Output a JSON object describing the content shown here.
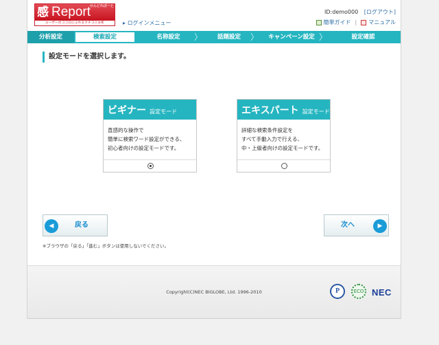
{
  "header": {
    "logo_heart": "感",
    "logo_name": "Report",
    "logo_ruby": "かんどれぽーと",
    "logo_tagline": "ユーザーのココロにふれるクチコミ分析",
    "login_menu": "ログインメニュー",
    "user_id": "ID:demo000",
    "logout": "[ログアウト]",
    "guide": "簡単ガイド",
    "manual": "マニュアル",
    "separator": "|"
  },
  "steps": [
    {
      "label": "分析設定"
    },
    {
      "label": "検索設定"
    },
    {
      "label": "名称設定"
    },
    {
      "label": "話題設定"
    },
    {
      "label": "キャンペーン設定"
    },
    {
      "label": "設定確認"
    }
  ],
  "instruction": "設定モードを選択します。",
  "modes": [
    {
      "title": "ビギナー",
      "suffix": "設定モード",
      "desc": [
        "直感的な操作で",
        "簡単に検索ワード設定ができる、",
        "初心者向けの設定モードです。"
      ],
      "selected": true
    },
    {
      "title": "エキスパート",
      "suffix": "設定モード",
      "desc": [
        "詳細な検索条件設定を",
        "すべて手動入力で行える、",
        "中・上級者向けの設定モードです。"
      ],
      "selected": false
    }
  ],
  "nav": {
    "back": "戻る",
    "next": "次へ",
    "back_icon": "◀",
    "next_icon": "▶",
    "note": "※ブラウザの「戻る」「進む」ボタンは使用しないでください。"
  },
  "footer": {
    "copyright": "Copyright(C)NEC BIGLOBE, Ltd. 1996-2010",
    "privacy_mark": "P",
    "eco_mark": "ECO",
    "nec": "NEC"
  },
  "colors": {
    "accent": "#25b5c0",
    "link": "#2f6fa7",
    "brand": "#c81e2c"
  }
}
